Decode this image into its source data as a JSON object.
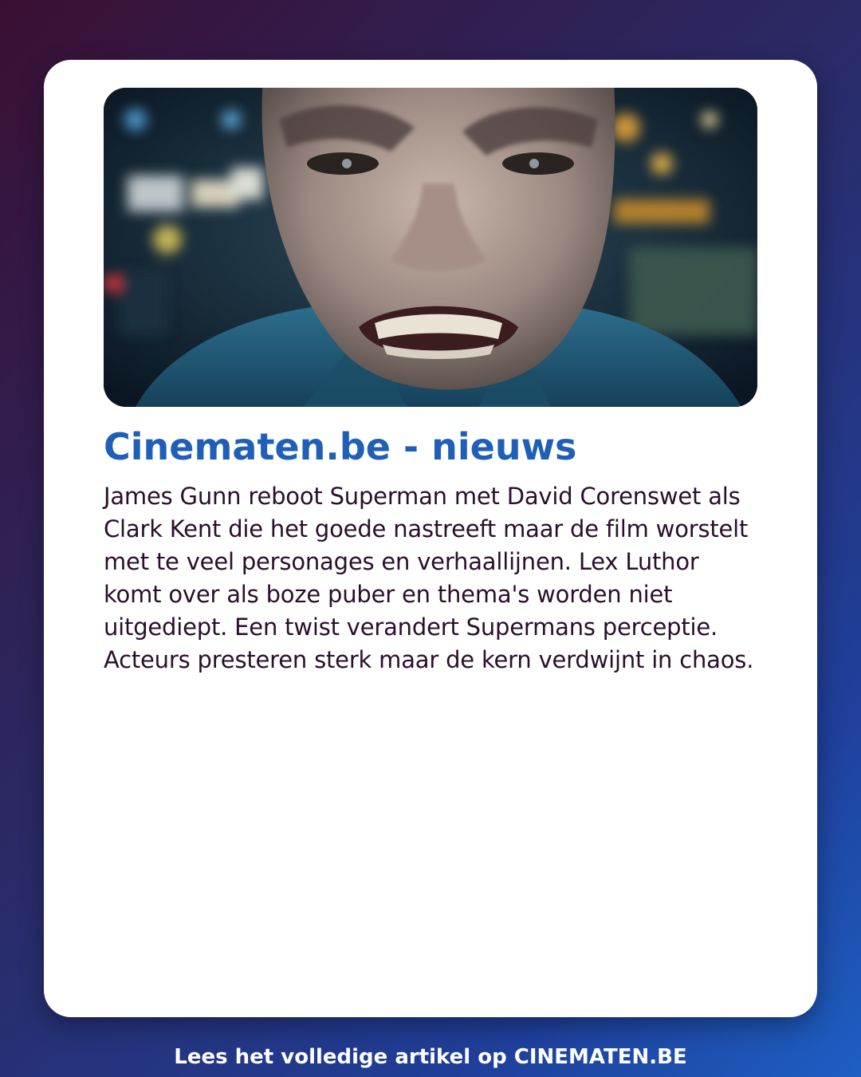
{
  "card": {
    "image": {
      "semantic": "film still: bald man grimacing with clenched teeth, blurred city lights behind"
    },
    "title": "Cinematen.be - nieuws",
    "summary": "James Gunn reboot Superman met David Corenswet als Clark Kent die het goede nastreeft maar de film worstelt met te veel personages en verhaallijnen. Lex Luthor komt over als boze puber en thema's worden niet uitgediept. Een twist verandert Supermans perceptie. Acteurs presteren sterk maar de kern verdwijnt in chaos."
  },
  "footer": {
    "text": "Lees het volledige artikel op CINEMATEN.BE"
  },
  "colors": {
    "title": "#1f5fb8",
    "body_text": "#2a0f2a",
    "card_background": "#ffffff",
    "footer_text": "#ffffff"
  }
}
